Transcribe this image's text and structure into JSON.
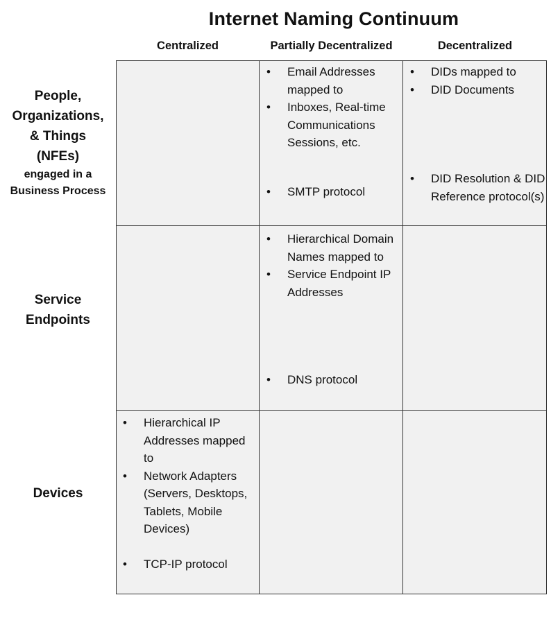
{
  "title": "Internet Naming  Continuum",
  "columns": [
    "Centralized",
    "Partially Decentralized",
    "Decentralized"
  ],
  "rows": [
    {
      "label_main": [
        "People,",
        "Organizations,",
        "& Things",
        "(NFEs)"
      ],
      "label_sub": [
        "engaged in a",
        "Business Process"
      ],
      "cells": [
        [],
        [
          "Email Addresses mapped to",
          "Inboxes, Real-time Communications Sessions, etc.",
          "SMTP protocol"
        ],
        [
          "DIDs mapped to",
          "DID Documents",
          "DID Resolution & DID Reference protocol(s)"
        ]
      ]
    },
    {
      "label_main": [
        "Service",
        "Endpoints"
      ],
      "label_sub": [],
      "cells": [
        [],
        [
          "Hierarchical Domain Names mapped to",
          "Service Endpoint IP Addresses",
          "DNS protocol"
        ],
        []
      ]
    },
    {
      "label_main": [
        "Devices"
      ],
      "label_sub": [],
      "cells": [
        [
          "Hierarchical IP Addresses mapped to",
          "Network Adapters (Servers, Desktops, Tablets, Mobile Devices)",
          "TCP-IP protocol"
        ],
        [],
        []
      ]
    }
  ],
  "bullet_glyph": "•"
}
